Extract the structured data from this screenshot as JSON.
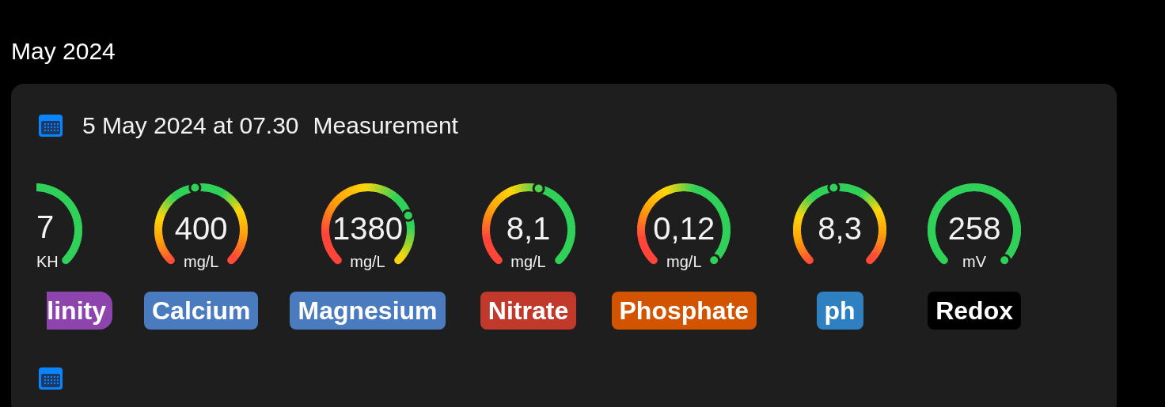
{
  "month_heading": "May 2024",
  "entries": [
    {
      "date": "5 May 2024 at 07.30",
      "type": "Measurement",
      "gauges": [
        {
          "kind": "clipped",
          "value": "7",
          "unit": "KH",
          "label": "linity",
          "color": "#8e44ad"
        },
        {
          "kind": "center",
          "value": "400",
          "unit": "mg/L",
          "label": "Calcium",
          "color": "#4a7bbf"
        },
        {
          "kind": "high",
          "value": "1380",
          "unit": "mg/L",
          "label": "Magnesium",
          "color": "#4a7bbf"
        },
        {
          "kind": "rising",
          "value": "8,1",
          "unit": "mg/L",
          "label": "Nitrate",
          "color": "#c0392b"
        },
        {
          "kind": "low",
          "value": "0,12",
          "unit": "mg/L",
          "label": "Phosphate",
          "color": "#d35400"
        },
        {
          "kind": "center",
          "value": "8,3",
          "label": "ph",
          "color": "#2e80c0"
        },
        {
          "kind": "flat",
          "value": "258",
          "unit": "mV",
          "label": "Redox",
          "color": "#000000"
        }
      ]
    }
  ]
}
